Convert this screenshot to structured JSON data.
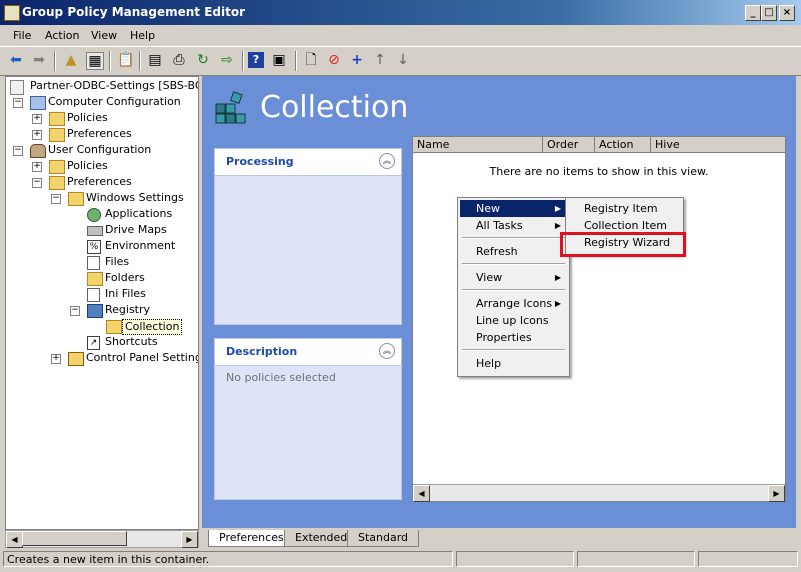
{
  "window": {
    "title": "Group Policy Management Editor"
  },
  "menubar": [
    "File",
    "Action",
    "View",
    "Help"
  ],
  "toolbar": {
    "icons": [
      "back-arrow-icon",
      "forward-arrow-icon",
      "up-folder-icon",
      "show-hide-tree-icon",
      "copy-icon",
      "properties-icon",
      "print-icon",
      "refresh-icon",
      "export-icon",
      "help-icon",
      "view-icon",
      "new-document-icon",
      "stop-icon",
      "add-icon",
      "move-up-icon",
      "move-down-icon"
    ]
  },
  "tree": {
    "root": "Partner-ODBC-Settings [SBS-BORC",
    "items": [
      {
        "label": "Computer Configuration",
        "level": 1,
        "expander": "−",
        "icon": "computer"
      },
      {
        "label": "Policies",
        "level": 2,
        "expander": "+",
        "icon": "folder"
      },
      {
        "label": "Preferences",
        "level": 2,
        "expander": "+",
        "icon": "folder"
      },
      {
        "label": "User Configuration",
        "level": 1,
        "expander": "−",
        "icon": "users"
      },
      {
        "label": "Policies",
        "level": 2,
        "expander": "+",
        "icon": "folder"
      },
      {
        "label": "Preferences",
        "level": 2,
        "expander": "−",
        "icon": "folder"
      },
      {
        "label": "Windows Settings",
        "level": 3,
        "expander": "−",
        "icon": "folder"
      },
      {
        "label": "Applications",
        "level": 4,
        "expander": "",
        "icon": "globe"
      },
      {
        "label": "Drive Maps",
        "level": 4,
        "expander": "",
        "icon": "drive"
      },
      {
        "label": "Environment",
        "level": 4,
        "expander": "",
        "icon": "env"
      },
      {
        "label": "Files",
        "level": 4,
        "expander": "",
        "icon": "file"
      },
      {
        "label": "Folders",
        "level": 4,
        "expander": "",
        "icon": "folder"
      },
      {
        "label": "Ini Files",
        "level": 4,
        "expander": "",
        "icon": "file"
      },
      {
        "label": "Registry",
        "level": 4,
        "expander": "−",
        "icon": "registry"
      },
      {
        "label": "Collection",
        "level": 5,
        "expander": "",
        "icon": "folder",
        "selected": true
      },
      {
        "label": "Shortcuts",
        "level": 4,
        "expander": "",
        "icon": "shortcut"
      },
      {
        "label": "Control Panel Settings",
        "level": 3,
        "expander": "+",
        "icon": "controlpanel"
      }
    ]
  },
  "main": {
    "title": "Collection",
    "processing_label": "Processing",
    "description_label": "Description",
    "description_text": "No policies selected",
    "columns": [
      "Name",
      "Order",
      "Action",
      "Hive"
    ],
    "empty_message": "There are no items to show in this view."
  },
  "context_menu": {
    "items": [
      "New",
      "All Tasks",
      "Refresh",
      "View",
      "Arrange Icons",
      "Line up Icons",
      "Properties",
      "Help"
    ]
  },
  "submenu": {
    "items": [
      "Registry Item",
      "Collection Item",
      "Registry Wizard"
    ]
  },
  "tabs": [
    "Preferences",
    "Extended",
    "Standard"
  ],
  "status": {
    "text": "Creates a new item in this container."
  },
  "colors": {
    "panel_bg": "#6b8fd6",
    "highlight": "#0a246a",
    "callout": "#e0101e"
  }
}
